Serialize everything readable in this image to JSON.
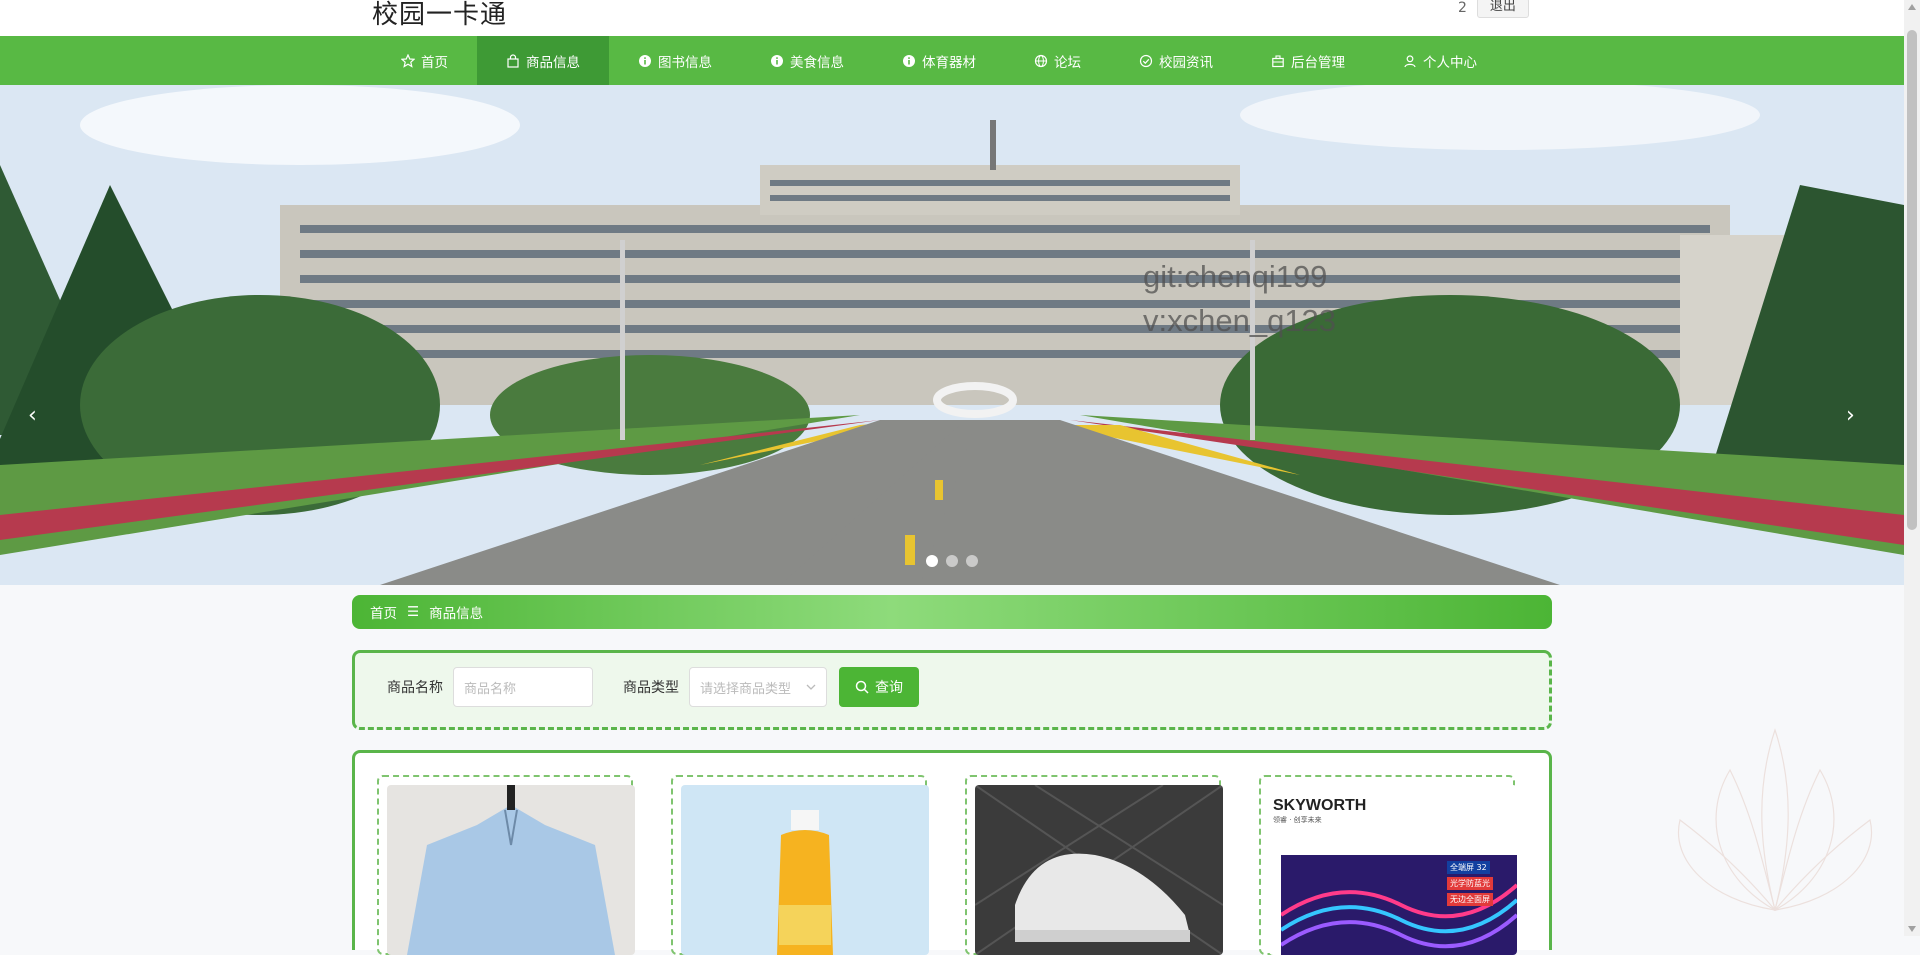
{
  "header": {
    "title": "校园一卡通",
    "user": "2",
    "logout": "退出"
  },
  "nav": [
    {
      "label": "首页",
      "icon": "star-icon",
      "active": false
    },
    {
      "label": "商品信息",
      "icon": "bag-icon",
      "active": true
    },
    {
      "label": "图书信息",
      "icon": "info-icon",
      "active": false
    },
    {
      "label": "美食信息",
      "icon": "info-icon",
      "active": false
    },
    {
      "label": "体育器材",
      "icon": "info-icon",
      "active": false
    },
    {
      "label": "论坛",
      "icon": "globe-icon",
      "active": false
    },
    {
      "label": "校园资讯",
      "icon": "check-circle-icon",
      "active": false
    },
    {
      "label": "后台管理",
      "icon": "briefcase-icon",
      "active": false
    },
    {
      "label": "个人中心",
      "icon": "user-icon",
      "active": false
    }
  ],
  "banner": {
    "watermark_line1": "git:chenqi199",
    "watermark_line2": "v:xchen_q123",
    "prev": "‹",
    "next": "›",
    "dots": 3,
    "active_dot": 0
  },
  "breadcrumb": {
    "home": "首页",
    "separator": "☰",
    "current": "商品信息"
  },
  "search": {
    "name_label": "商品名称",
    "name_placeholder": "商品名称",
    "type_label": "商品类型",
    "type_placeholder": "请选择商品类型",
    "button": "查询"
  },
  "products": [
    {
      "image": "blue-shirt"
    },
    {
      "image": "juice-bottle"
    },
    {
      "image": "white-sneaker"
    },
    {
      "image": "tv",
      "brand": "SKYWORTH",
      "brand_sub": "领睿 · 创享未来",
      "tag1": "全端屏",
      "tag_num": "32",
      "tag2": "光学防蓝光",
      "tag3": "无边全面屏"
    }
  ],
  "colors": {
    "nav": "#58b944",
    "nav_active": "#3e9a35",
    "accent": "#4cb535"
  }
}
